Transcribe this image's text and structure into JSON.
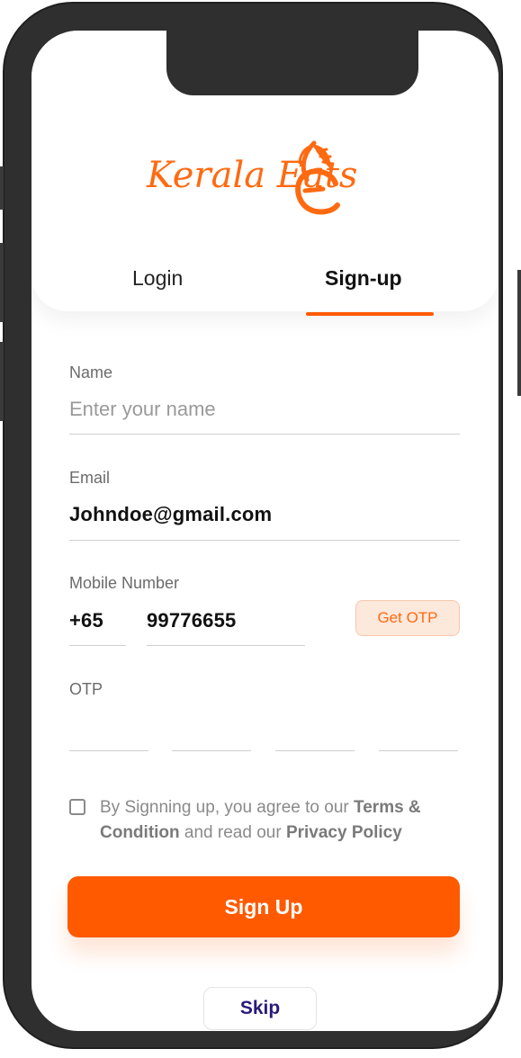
{
  "brand": {
    "name": "KeralaEats",
    "logo_text": "Kerala Eats",
    "accent_color": "#ff5a00"
  },
  "tabs": {
    "login": "Login",
    "signup": "Sign-up",
    "active": "Sign-up"
  },
  "form": {
    "name": {
      "label": "Name",
      "placeholder": "Enter your name",
      "value": ""
    },
    "email": {
      "label": "Email",
      "value": "Johndoe@gmail.com"
    },
    "mobile": {
      "label": "Mobile Number",
      "country_code": "+65",
      "value": "99776655",
      "otp_button": "Get OTP"
    },
    "otp": {
      "label": "OTP",
      "digits": [
        "",
        "",
        "",
        ""
      ]
    },
    "terms": {
      "prefix": "By Signning up, you agree to our ",
      "terms_link": "Terms & Condition",
      "middle": " and read our ",
      "privacy_link": "Privacy Policy",
      "checked": false
    },
    "submit_label": "Sign Up",
    "skip_label": "Skip"
  }
}
